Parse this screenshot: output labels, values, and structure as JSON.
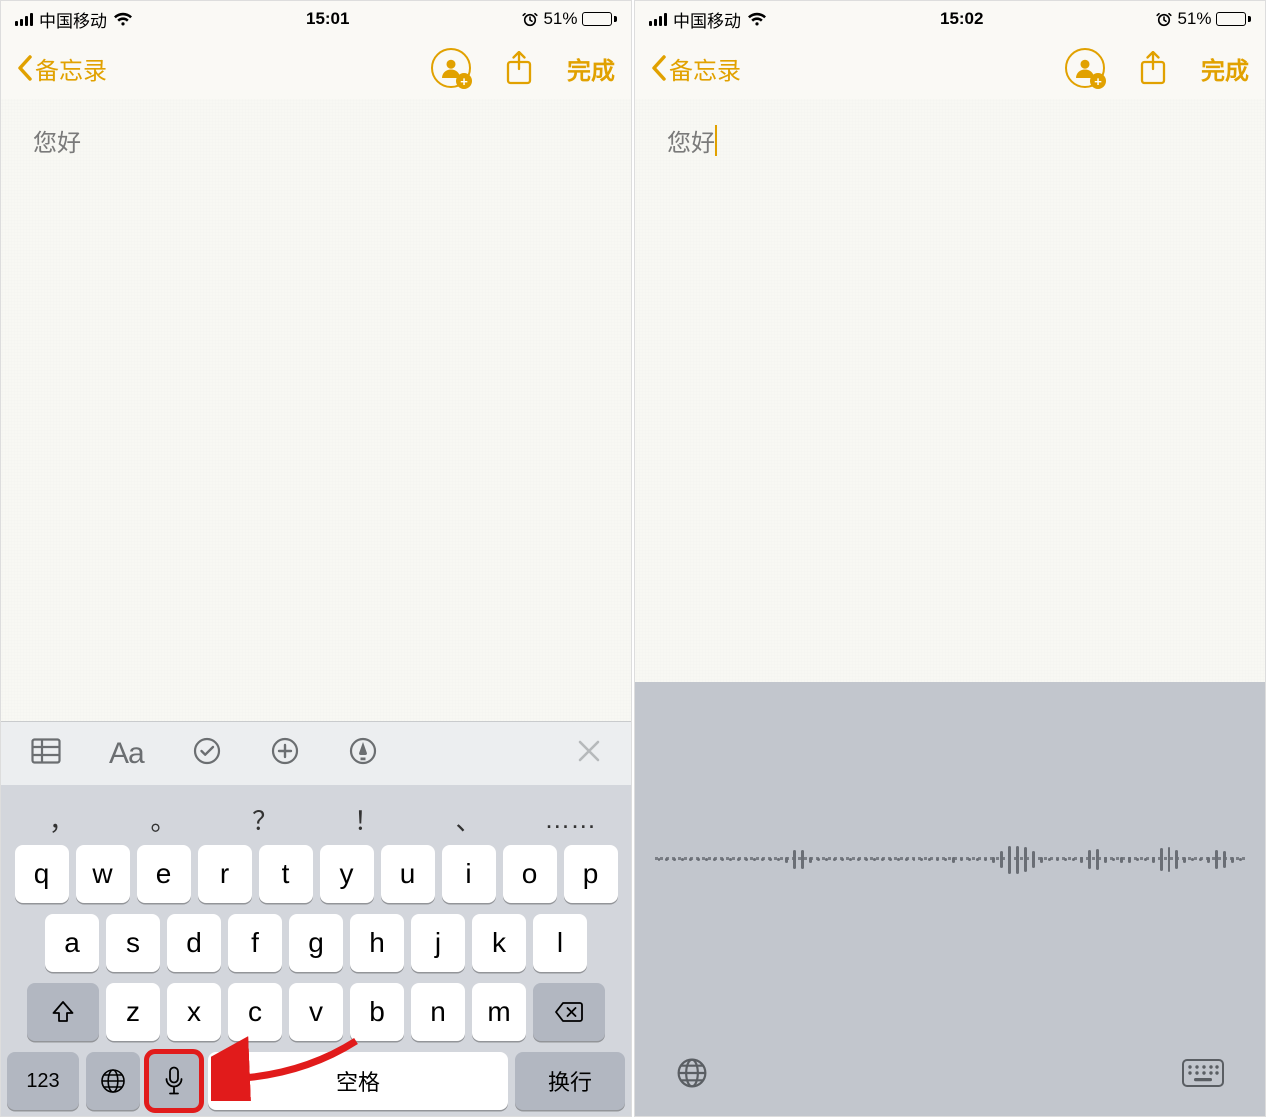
{
  "left": {
    "status": {
      "carrier": "中国移动",
      "time": "15:01",
      "battery_pct": "51%"
    },
    "nav": {
      "back": "备忘录",
      "done": "完成"
    },
    "note_text": "您好",
    "format_bar": {
      "aa": "Aa"
    },
    "candidates": [
      "，",
      "。",
      "？",
      "！",
      "、",
      "……"
    ],
    "keyboard": {
      "row1": [
        "q",
        "w",
        "e",
        "r",
        "t",
        "y",
        "u",
        "i",
        "o",
        "p"
      ],
      "row2": [
        "a",
        "s",
        "d",
        "f",
        "g",
        "h",
        "j",
        "k",
        "l"
      ],
      "row3": [
        "z",
        "x",
        "c",
        "v",
        "b",
        "n",
        "m"
      ],
      "num_key": "123",
      "space": "空格",
      "enter": "换行"
    }
  },
  "right": {
    "status": {
      "carrier": "中国移动",
      "time": "15:02",
      "battery_pct": "51%"
    },
    "nav": {
      "back": "备忘录",
      "done": "完成"
    },
    "note_text": "您好"
  }
}
